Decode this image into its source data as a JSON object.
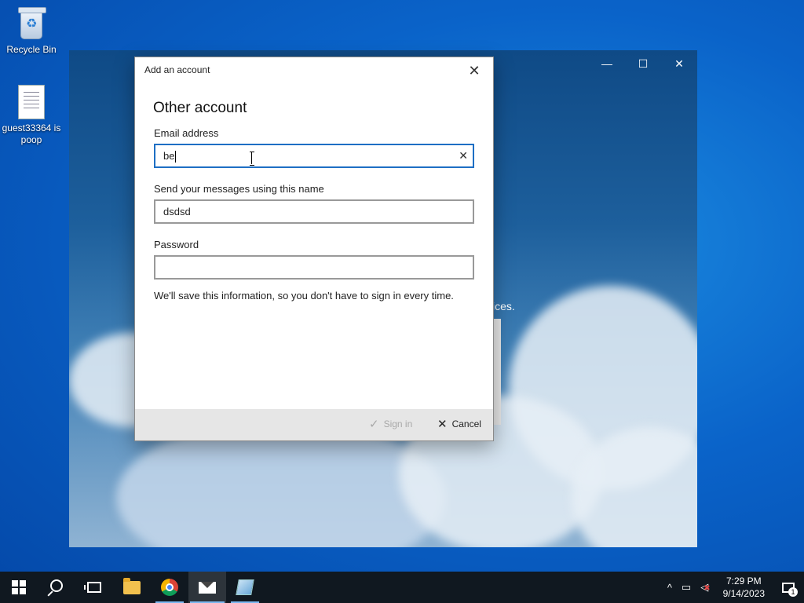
{
  "desktop": {
    "icons": [
      {
        "label": "Recycle Bin"
      },
      {
        "label": "guest33364 is poop"
      }
    ]
  },
  "app_window": {
    "partial_text": "ices.",
    "controls": {
      "minimize": "—",
      "maximize": "☐",
      "close": "✕"
    }
  },
  "dialog": {
    "title": "Add an account",
    "close_glyph": "✕",
    "heading": "Other account",
    "email": {
      "label": "Email address",
      "value": "be",
      "clear_glyph": "✕"
    },
    "name": {
      "label": "Send your messages using this name",
      "value": "dsdsd"
    },
    "password": {
      "label": "Password",
      "value": ""
    },
    "info_text": "We'll save this information, so you don't have to sign in every time.",
    "buttons": {
      "signin": {
        "label": "Sign in",
        "icon": "✓",
        "enabled": false
      },
      "cancel": {
        "label": "Cancel",
        "icon": "✕"
      }
    }
  },
  "taskbar": {
    "apps": [
      "start",
      "search",
      "task-view",
      "file-explorer",
      "chrome",
      "mail",
      "app"
    ],
    "tray": {
      "chevron": "^",
      "time": "7:29 PM",
      "date": "9/14/2023",
      "notification_count": "1"
    }
  }
}
